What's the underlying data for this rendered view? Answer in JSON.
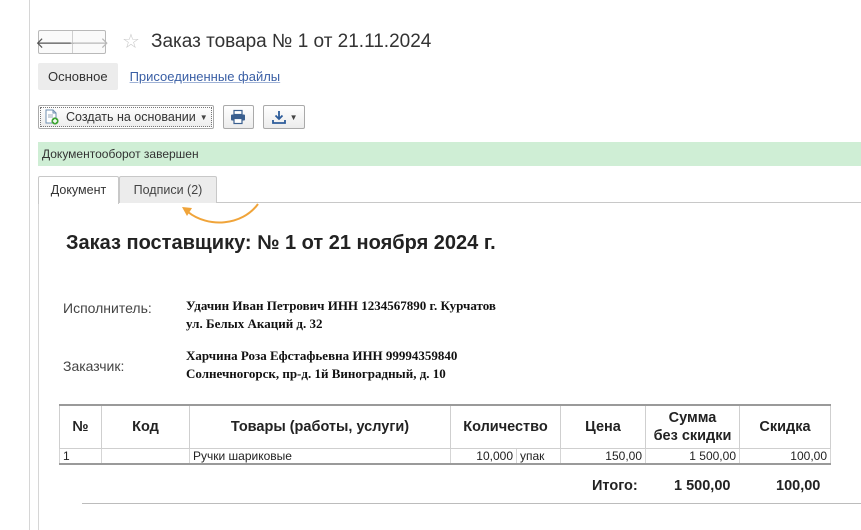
{
  "window": {
    "title": "Заказ товара № 1 от 21.11.2024",
    "nav_back": "🡐",
    "nav_forward": "🡒",
    "favorite_icon": "☆"
  },
  "section_tabs": [
    {
      "label": "Основное"
    },
    {
      "label": "Присоединенные файлы"
    }
  ],
  "toolbar": {
    "create_based_on_label": "Создать на основании"
  },
  "status": {
    "text": "Документооборот завершен"
  },
  "inner_tabs": [
    {
      "label": "Документ"
    },
    {
      "label": "Подписи (2)"
    }
  ],
  "document": {
    "title": "Заказ поставщику: № 1 от 21 ноября 2024 г.",
    "executor_label": "Исполнитель:",
    "executor_line1": "Удачин Иван Петрович ИНН 1234567890 г. Курчатов",
    "executor_line2": "ул. Белых Акаций д. 32",
    "customer_label": "Заказчик:",
    "customer_line1": "Харчина Роза Ефстафьевна ИНН 99994359840",
    "customer_line2": "Солнечногорск, пр-д. 1й Виноградный, д. 10"
  },
  "table": {
    "headers": {
      "num": "№",
      "code": "Код",
      "goods": "Товары (работы, услуги)",
      "qty": "Количество",
      "price": "Цена",
      "sum_line1": "Сумма",
      "sum_line2": "без скидки",
      "discount": "Скидка"
    },
    "rows": [
      {
        "num": "1",
        "code": "",
        "goods": "Ручки шариковые",
        "qty": "10,000",
        "unit": "упак",
        "price": "150,00",
        "sum": "1 500,00",
        "discount": "100,00"
      }
    ],
    "totals": {
      "label": "Итого:",
      "sum": "1 500,00",
      "discount": "100,00"
    }
  },
  "colors": {
    "status_bg": "#cfeed5",
    "link": "#3a5fa5",
    "arrow": "#f0a43a"
  },
  "icons": [
    "back-arrow-icon",
    "forward-arrow-icon",
    "star-icon",
    "document-create-icon",
    "printer-icon",
    "download-icon",
    "dropdown-icon"
  ]
}
